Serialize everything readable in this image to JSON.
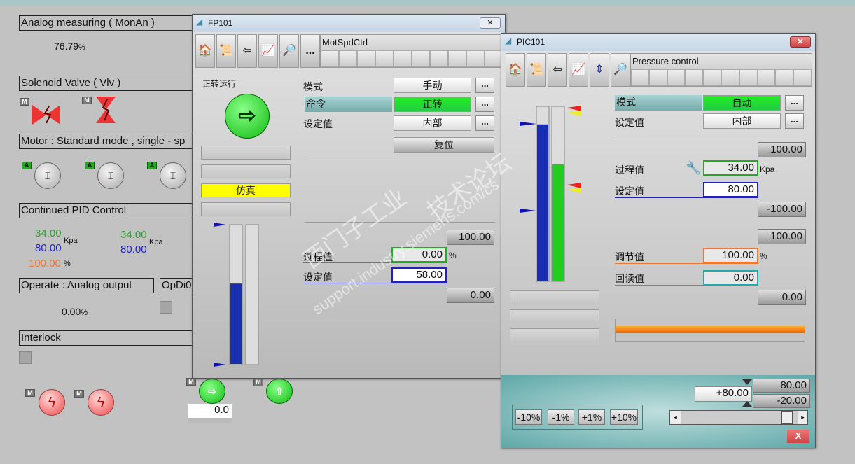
{
  "left": {
    "analog_title": "Analog measuring ( MonAn )",
    "analog_value": "76.79",
    "analog_unit": "%",
    "valve_title": "Solenoid Valve ( Vlv )",
    "m": "M",
    "a": "A",
    "motor_title": "Motor : Standard mode , single - sp",
    "pid_title": "Continued PID Control",
    "pid1": {
      "pv": "34.00",
      "sp": "80.00",
      "unit": "Kpa",
      "out": "100.00",
      "out_unit": "%"
    },
    "pid2": {
      "pv": "34.00",
      "sp": "80.00",
      "unit": "Kpa"
    },
    "opana_title": "Operate : Analog output",
    "opana_value": "0.00",
    "opana_unit": "%",
    "opdi_title": "OpDi0",
    "interlock_title": "Interlock",
    "speed_value": "0.0"
  },
  "fp101": {
    "title": "FP101",
    "tag": "MotSpdCtrl",
    "more": "...",
    "status": "正转运行",
    "sim": "仿真",
    "mode_label": "模式",
    "mode_value": "手动",
    "cmd_label": "命令",
    "cmd_value": "正转",
    "sp_label": "设定值",
    "sp_value": "内部",
    "reset": "复位",
    "hi": "100.00",
    "pv_label": "过程值",
    "pv": "0.00",
    "pv_unit": "%",
    "sp2_label": "设定值",
    "sp2": "58.00",
    "lo": "0.00",
    "bar_fill": 0.58
  },
  "pic101": {
    "title": "PIC101",
    "tag": "Pressure control",
    "mode_label": "模式",
    "mode_value": "自动",
    "sp_label": "设定值",
    "sp_value": "内部",
    "hi": "100.00",
    "pv_label": "过程值",
    "pv": "34.00",
    "pv_unit": "Kpa",
    "sp2_label": "设定值",
    "sp2": "80.00",
    "lo": "-100.00",
    "out_hi": "100.00",
    "out_label": "调节值",
    "out": "100.00",
    "out_unit": "%",
    "rb_label": "回读值",
    "rb": "0.00",
    "out_lo": "0.00",
    "step_buttons": [
      "-10%",
      "-1%",
      "+1%",
      "+10%"
    ],
    "input": "+80.00",
    "limit_hi": "80.00",
    "limit_lo": "-20.00",
    "close": "X",
    "slider_fraction": 0.95,
    "pv_bar_fill": 0.9,
    "out_bar_fill": 0.67
  },
  "watermark": [
    "西门子工业",
    "技术论坛",
    "support.industry.siemens.com/cs"
  ]
}
